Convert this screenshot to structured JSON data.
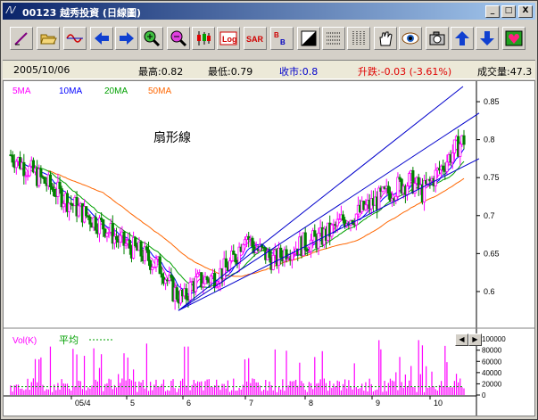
{
  "window": {
    "title": "00123  越秀投資  (日線圖)",
    "min_label": "_",
    "max_label": "□",
    "close_label": "X"
  },
  "toolbar": {
    "items": [
      {
        "name": "draw-line",
        "icon": "pencil-icon"
      },
      {
        "name": "open",
        "icon": "folder-open-icon"
      },
      {
        "name": "wave",
        "icon": "sine-wave-icon"
      },
      {
        "name": "scroll-left",
        "icon": "arrow-left-icon"
      },
      {
        "name": "scroll-right",
        "icon": "arrow-right-icon"
      },
      {
        "name": "zoom-in",
        "icon": "zoom-in-icon"
      },
      {
        "name": "zoom-out",
        "icon": "zoom-out-icon"
      },
      {
        "name": "candles",
        "icon": "candlestick-icon"
      },
      {
        "name": "log-scale",
        "icon": "log-icon",
        "label": "Log"
      },
      {
        "name": "sar",
        "icon": "sar-icon",
        "label": "SAR"
      },
      {
        "name": "bollinger",
        "icon": "bb-icon",
        "label": "B B"
      },
      {
        "name": "contrast",
        "icon": "contrast-icon"
      },
      {
        "name": "grid-h",
        "icon": "grid-rows-icon"
      },
      {
        "name": "grid-v",
        "icon": "grid-cols-icon"
      },
      {
        "name": "hand",
        "icon": "hand-icon"
      },
      {
        "name": "eye",
        "icon": "eye-icon"
      },
      {
        "name": "camera",
        "icon": "camera-icon"
      },
      {
        "name": "up",
        "icon": "arrow-up-icon"
      },
      {
        "name": "down",
        "icon": "arrow-down-icon"
      },
      {
        "name": "favorite",
        "icon": "heart-icon"
      }
    ]
  },
  "info": {
    "date": "2005/10/06",
    "high": "最高:0.82",
    "low": "最低:0.79",
    "close": "收市:0.8",
    "change": "升跌:-0.03 (-3.61%)",
    "volume": "成交量:47.3"
  },
  "colors": {
    "ma5": "#ff00ff",
    "ma10": "#0000ff",
    "ma20": "#00a000",
    "ma50": "#ff6600",
    "up": "#ff00ff",
    "down": "#008000",
    "fan": "#0000cc",
    "vol": "#ff00ff",
    "volavg": "#00a000"
  },
  "legend": {
    "ma5": "5MA",
    "ma10": "10MA",
    "ma20": "20MA",
    "ma50": "50MA"
  },
  "annotation": {
    "text": "扇形線"
  },
  "volume_panel": {
    "label": "Vol(K)",
    "avg_label": "平均"
  },
  "chart_data": {
    "type": "candlestick",
    "price_ticks": [
      0.85,
      0.8,
      0.75,
      0.7,
      0.65,
      0.6
    ],
    "price_range": [
      0.56,
      0.87
    ],
    "volume_ticks": [
      100000,
      80000,
      60000,
      40000,
      20000,
      0
    ],
    "volume_range": [
      0,
      105000
    ],
    "x_labels": [
      "05/4",
      "5",
      "6",
      "7",
      "8",
      "9",
      "10"
    ],
    "fan_lines": "three trendlines from the June low near 0.575",
    "close_path": [
      [
        0,
        0.78
      ],
      [
        10,
        0.76
      ],
      [
        20,
        0.74
      ],
      [
        30,
        0.72
      ],
      [
        40,
        0.7
      ],
      [
        50,
        0.685
      ],
      [
        58,
        0.665
      ],
      [
        66,
        0.655
      ],
      [
        72,
        0.645
      ],
      [
        80,
        0.63
      ],
      [
        86,
        0.6
      ],
      [
        92,
        0.59
      ],
      [
        96,
        0.61
      ],
      [
        102,
        0.615
      ],
      [
        108,
        0.62
      ],
      [
        114,
        0.63
      ],
      [
        120,
        0.65
      ],
      [
        124,
        0.68
      ],
      [
        128,
        0.66
      ],
      [
        134,
        0.65
      ],
      [
        140,
        0.64
      ],
      [
        146,
        0.655
      ],
      [
        152,
        0.66
      ],
      [
        158,
        0.665
      ],
      [
        164,
        0.67
      ],
      [
        170,
        0.68
      ],
      [
        176,
        0.695
      ],
      [
        182,
        0.7
      ],
      [
        188,
        0.71
      ],
      [
        194,
        0.72
      ],
      [
        200,
        0.73
      ],
      [
        206,
        0.74
      ],
      [
        212,
        0.745
      ],
      [
        218,
        0.73
      ],
      [
        224,
        0.75
      ],
      [
        230,
        0.77
      ],
      [
        236,
        0.79
      ],
      [
        240,
        0.8
      ]
    ]
  }
}
